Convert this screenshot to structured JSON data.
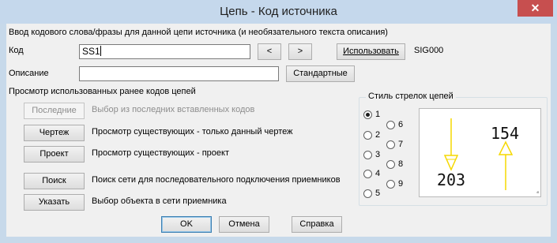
{
  "window": {
    "title": "Цепь - Код источника",
    "close_glyph": "✕"
  },
  "intro": "Ввод кодового слова/фразы для данной цепи источника (и необязательного текста описания)",
  "code": {
    "label": "Код",
    "value": "SS1",
    "prev_label": "<",
    "next_label": ">",
    "use_label": "Использовать",
    "use_value": "SIG000"
  },
  "description": {
    "label": "Описание",
    "value": "",
    "standard_label": "Стандартные"
  },
  "browse": {
    "heading": "Просмотр использованных ранее кодов цепей",
    "items": [
      {
        "button": "Последние",
        "text": "Выбор из последних вставленных кодов",
        "enabled": false
      },
      {
        "button": "Чертеж",
        "text": "Просмотр существующих - только данный чертеж",
        "enabled": true
      },
      {
        "button": "Проект",
        "text": "Просмотр существующих - проект",
        "enabled": true
      },
      {
        "button": "Поиск",
        "text": "Поиск сети для последовательного подключения приемников",
        "enabled": true
      },
      {
        "button": "Указать",
        "text": "Выбор объекта в сети приемника",
        "enabled": true
      }
    ]
  },
  "arrow_style": {
    "label": "Стиль стрелок цепей",
    "options": [
      "1",
      "2",
      "3",
      "4",
      "5",
      "6",
      "7",
      "8",
      "9"
    ],
    "selected": "1",
    "preview": {
      "left_code": "203",
      "right_code": "154",
      "arrow_color": "#f5d800"
    }
  },
  "footer": {
    "ok_label": "OK",
    "cancel_label": "Отмена",
    "help_label": "Справка"
  }
}
